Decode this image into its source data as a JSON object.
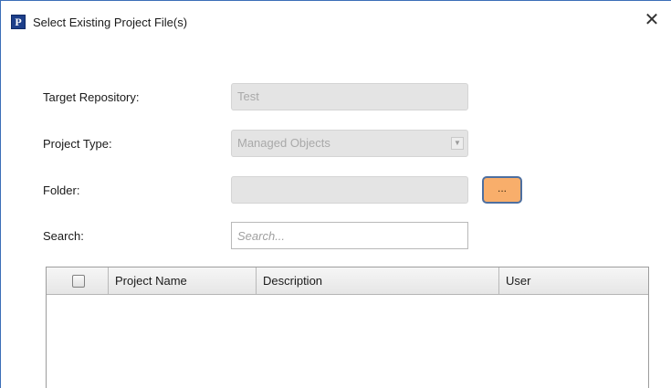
{
  "window": {
    "title": "Select Existing Project File(s)",
    "icon": "app-logo-icon",
    "icon_glyph": "P",
    "close_glyph": "✕"
  },
  "form": {
    "target_repository": {
      "label": "Target Repository:",
      "value": "Test"
    },
    "project_type": {
      "label": "Project Type:",
      "value": "Managed Objects",
      "arrow_glyph": "▼"
    },
    "folder": {
      "label": "Folder:",
      "value": "",
      "browse_label": "..."
    },
    "search": {
      "label": "Search:",
      "placeholder": "Search..."
    }
  },
  "table": {
    "columns": [
      "Project Name",
      "Description",
      "User"
    ],
    "rows": []
  },
  "colors": {
    "browse_button": "#f8ae6b",
    "title_border": "#3c6fb8"
  }
}
